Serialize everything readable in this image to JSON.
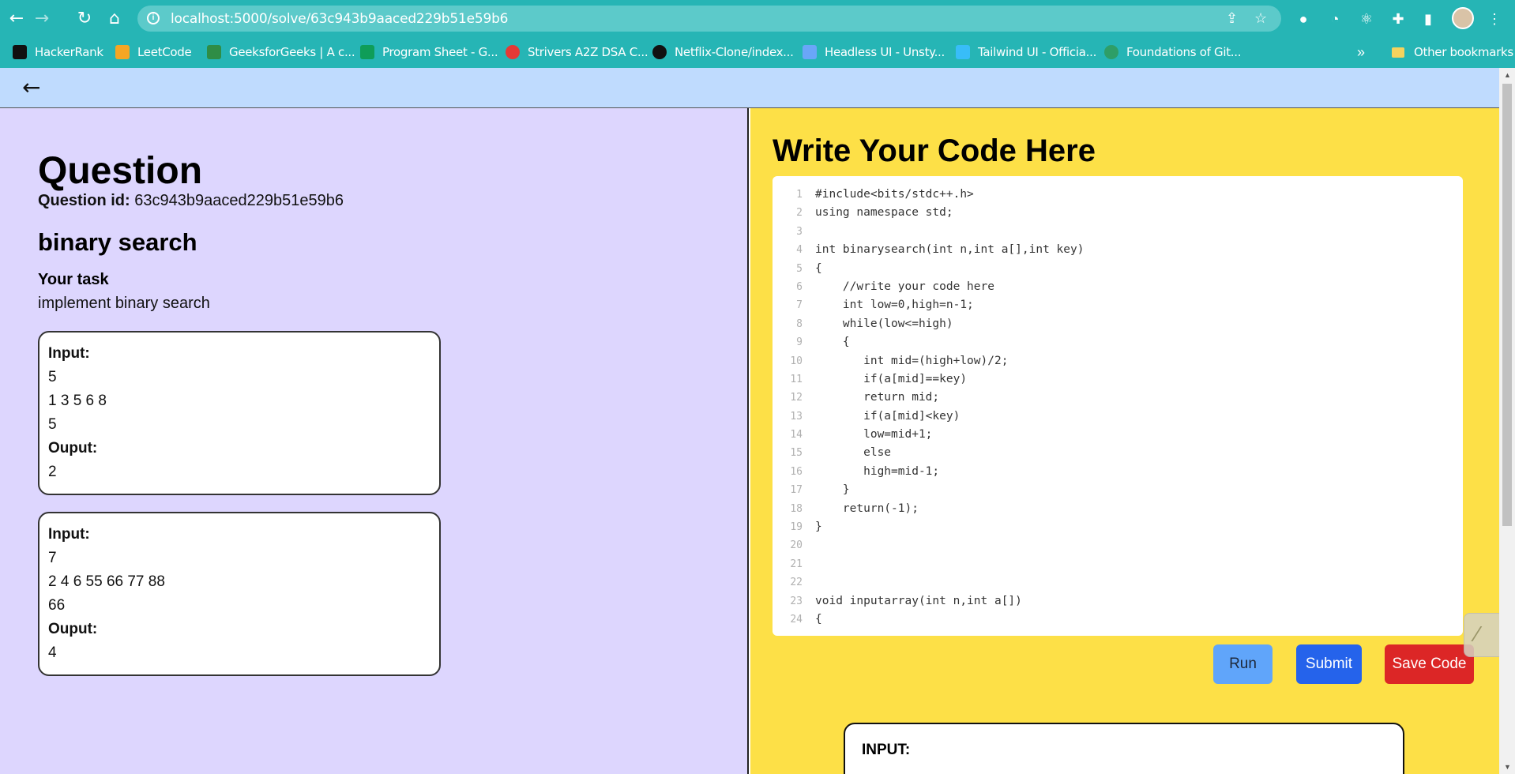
{
  "browser": {
    "url": "localhost:5000/solve/63c943b9aaced229b51e59b6",
    "bookmarks": [
      {
        "label": "HackerRank",
        "icon": "hackerrank-icon",
        "color": "#111111"
      },
      {
        "label": "LeetCode",
        "icon": "leetcode-icon",
        "color": "#f5a623"
      },
      {
        "label": "GeeksforGeeks | A c...",
        "icon": "geeksforgeeks-icon",
        "color": "#2f8d46"
      },
      {
        "label": "Program Sheet - G...",
        "icon": "sheets-icon",
        "color": "#0f9d58"
      },
      {
        "label": "Strivers A2Z DSA C...",
        "icon": "tuf-icon",
        "color": "#e53935"
      },
      {
        "label": "Netflix-Clone/index...",
        "icon": "github-icon",
        "color": "#111111"
      },
      {
        "label": "Headless UI - Unsty...",
        "icon": "headlessui-icon",
        "color": "#6aa6f8"
      },
      {
        "label": "Tailwind UI - Officia...",
        "icon": "tailwind-icon",
        "color": "#38bdf8"
      },
      {
        "label": "Foundations of Git...",
        "icon": "github-skills-icon",
        "color": "#2e9e67"
      }
    ],
    "more_label": "»",
    "other_bookmarks": "Other bookmarks"
  },
  "header": {
    "back_symbol": "←"
  },
  "question": {
    "title": "Question",
    "id_label": "Question id:",
    "id_value": "63c943b9aaced229b51e59b6",
    "name": "binary search",
    "task_label": "Your task",
    "task_desc": "implement binary search",
    "examples": [
      {
        "input_label": "Input:",
        "lines": [
          "5",
          "1 3 5 6 8",
          "5"
        ],
        "output_label": "Ouput:",
        "output": "2"
      },
      {
        "input_label": "Input:",
        "lines": [
          "7",
          "2 4 6 55 66 77 88",
          "66"
        ],
        "output_label": "Ouput:",
        "output": "4"
      }
    ]
  },
  "editor": {
    "title": "Write Your Code Here",
    "lines": [
      "#include<bits/stdc++.h>",
      "using namespace std;",
      "",
      "int binarysearch(int n,int a[],int key)",
      "{",
      "    //write your code here",
      "    int low=0,high=n-1;",
      "    while(low<=high)",
      "    {",
      "       int mid=(high+low)/2;",
      "       if(a[mid]==key)",
      "       return mid;",
      "       if(a[mid]<key)",
      "       low=mid+1;",
      "       else",
      "       high=mid-1;",
      "    }",
      "    return(-1);",
      "}",
      "",
      "",
      "",
      "void inputarray(int n,int a[])",
      "{"
    ]
  },
  "actions": {
    "run": "Run",
    "submit": "Submit",
    "save": "Save Code"
  },
  "io": {
    "input_label": "INPUT:"
  },
  "colors": {
    "chrome": "#26b5b5",
    "header": "#bfdbfe",
    "left_panel": "#ddd6fe",
    "right_panel": "#fde047",
    "run": "#60a5fa",
    "submit": "#2563eb",
    "save": "#dc2626"
  }
}
